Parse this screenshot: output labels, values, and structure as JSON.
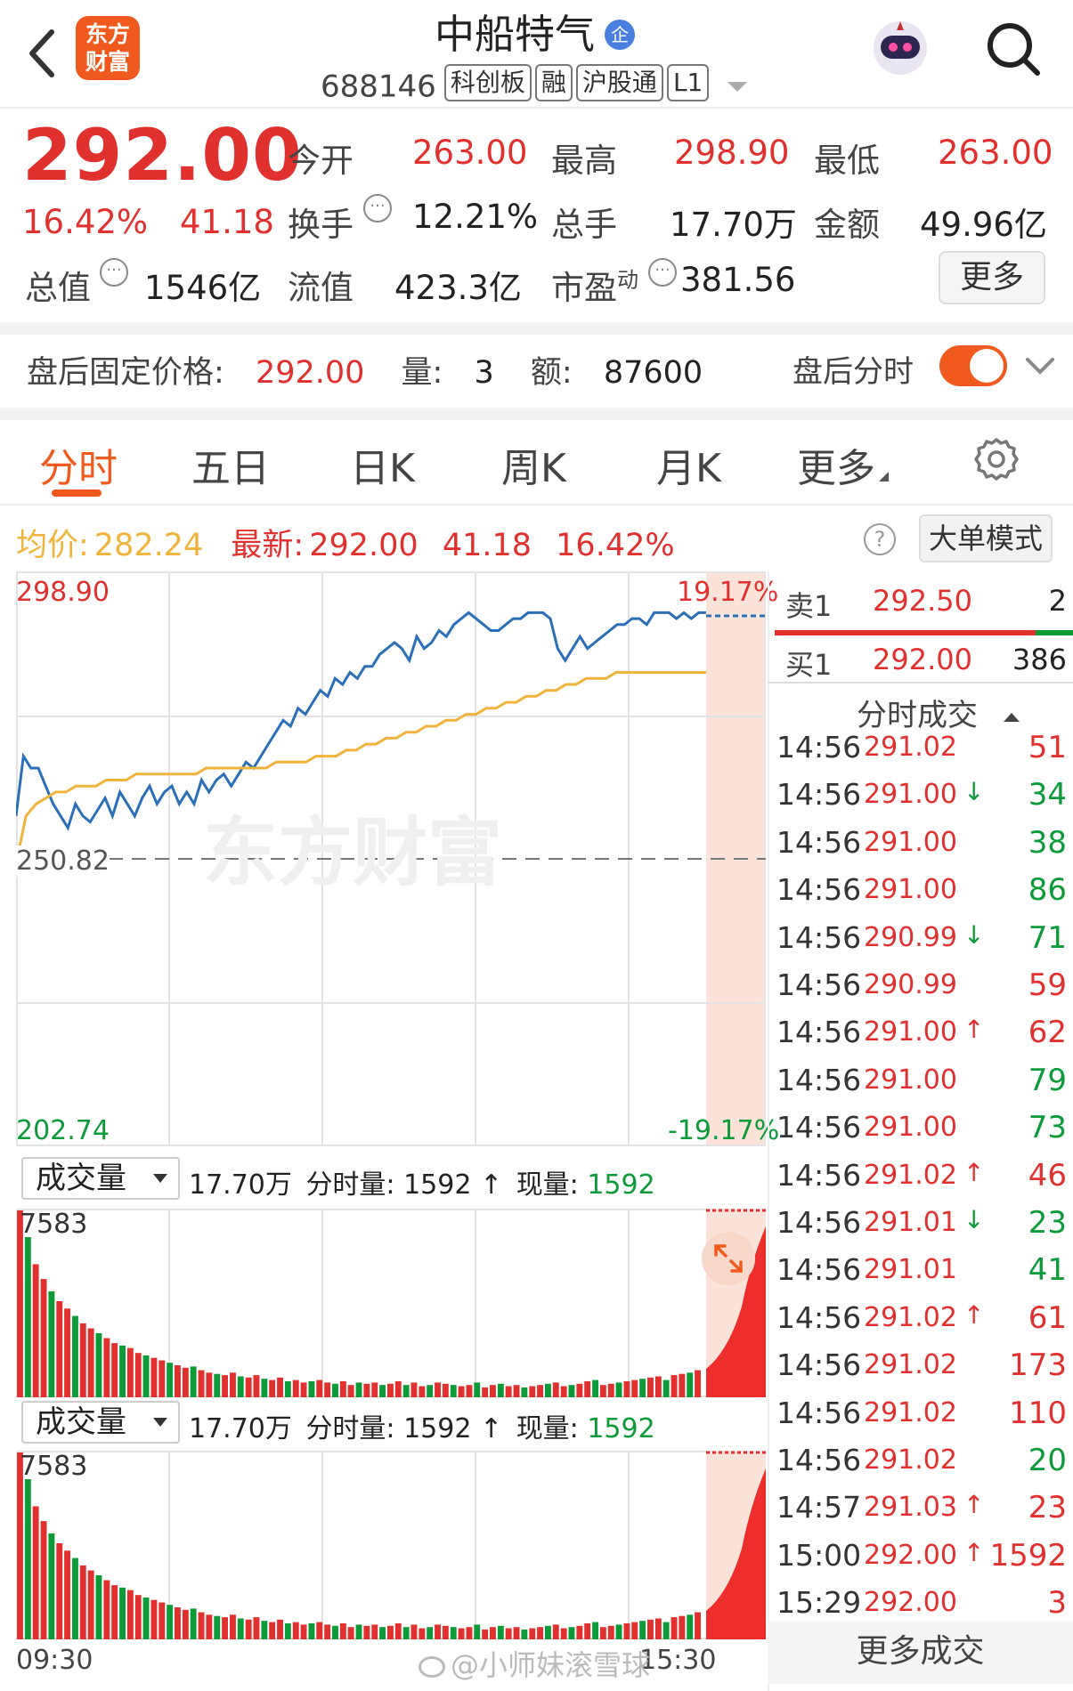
{
  "header": {
    "app_logo": "东方财富",
    "stock_name": "中船特气",
    "enterprise_badge": "企",
    "stock_code": "688146",
    "tags": [
      "科创板",
      "融",
      "沪股通",
      "L1"
    ]
  },
  "quote": {
    "price": "292.00",
    "change_pct": "16.42%",
    "change": "41.18",
    "stats": [
      {
        "label": "今开",
        "value": "263.00"
      },
      {
        "label": "最高",
        "value": "298.90"
      },
      {
        "label": "最低",
        "value": "263.00"
      },
      {
        "label": "换手",
        "value": "12.21%"
      },
      {
        "label": "总手",
        "value": "17.70万"
      },
      {
        "label": "金额",
        "value": "49.96亿"
      },
      {
        "label": "总值",
        "value": "1546亿"
      },
      {
        "label": "流值",
        "value": "423.3亿"
      },
      {
        "label": "市盈",
        "label_sup": "动",
        "value": "381.56"
      }
    ],
    "more_label": "更多"
  },
  "after_hours": {
    "price_label": "盘后固定价格:",
    "price": "292.00",
    "volume_label": "量:",
    "volume": "3",
    "amount_label": "额:",
    "amount": "87600",
    "toggle_label": "盘后分时",
    "toggle_on": true
  },
  "tabs": [
    "分时",
    "五日",
    "日K",
    "周K",
    "月K",
    "更多"
  ],
  "active_tab": 0,
  "info_bar": {
    "avg_label": "均价:",
    "avg": "282.24",
    "latest_label": "最新:",
    "latest": "292.00",
    "change": "41.18",
    "change_pct": "16.42%",
    "big_order_button": "大单模式"
  },
  "chart_data": [
    {
      "type": "line",
      "x_start": "09:30",
      "x_end": "15:30",
      "y_max": "298.90",
      "y_mid": "250.82",
      "y_min": "202.74",
      "pct_max": "19.17%",
      "pct_min": "-19.17%",
      "watermark": "东方财富",
      "ylim": [
        202.74,
        298.9
      ],
      "series": [
        {
          "values": [
            258,
            268,
            266,
            266,
            263,
            260,
            258,
            256,
            260,
            258,
            257,
            259,
            261,
            258,
            262,
            260,
            258,
            261,
            263,
            260,
            262,
            263,
            260,
            262,
            260,
            264,
            262,
            264,
            265,
            263,
            265,
            267,
            266,
            268,
            270,
            272,
            274,
            273,
            276,
            275,
            277,
            279,
            278,
            281,
            280,
            282,
            281,
            283,
            283,
            285,
            286,
            287,
            286,
            284,
            288,
            286,
            287,
            289,
            288,
            290,
            291,
            292,
            291,
            290,
            289,
            289,
            290,
            291,
            291,
            292,
            292,
            292,
            291,
            286,
            284,
            286,
            288,
            286,
            287,
            288,
            289,
            290,
            290,
            291,
            291,
            290,
            292,
            292,
            292,
            291,
            292,
            291,
            292,
            292
          ]
        },
        {
          "values": [
            250,
            258,
            260,
            261,
            262,
            262,
            263,
            263,
            263,
            264,
            264,
            264,
            265,
            265,
            265,
            265,
            265,
            265,
            265,
            266,
            266,
            266,
            266,
            266,
            266,
            266,
            267,
            267,
            267,
            267,
            268,
            268,
            268,
            269,
            269,
            270,
            270,
            271,
            271,
            272,
            272,
            273,
            273,
            274,
            274,
            275,
            275,
            276,
            276,
            277,
            277,
            278,
            278,
            279,
            279,
            280,
            280,
            281,
            281,
            281,
            282,
            282,
            282,
            282,
            282,
            282,
            282,
            282,
            282,
            282
          ]
        }
      ]
    },
    {
      "type": "bar",
      "title": "成交量",
      "ymax": "7583",
      "values": [
        7583,
        6500,
        5400,
        4800,
        4300,
        3900,
        3600,
        3300,
        3000,
        2800,
        2600,
        2400,
        2200,
        2100,
        2000,
        1800,
        1700,
        1600,
        1500,
        1400,
        1300,
        1200,
        1250,
        1100,
        1000,
        950,
        900,
        1000,
        850,
        800,
        900,
        750,
        700,
        800,
        650,
        700,
        600,
        650,
        700,
        600,
        550,
        650,
        500,
        600,
        550,
        600,
        500,
        550,
        650,
        500,
        600,
        450,
        500,
        600,
        550,
        500,
        450,
        500,
        600,
        400,
        500,
        550,
        450,
        500,
        400,
        450,
        500,
        550,
        600,
        450,
        500,
        550,
        650,
        700,
        500,
        550,
        600,
        650,
        700,
        750,
        800,
        850,
        700,
        900,
        950,
        1000,
        1100
      ]
    },
    {
      "type": "bar",
      "title": "成交量",
      "ymax": "7583",
      "values": [
        7583,
        6500,
        5400,
        4800,
        4300,
        3900,
        3600,
        3300,
        3000,
        2800,
        2600,
        2400,
        2200,
        2100,
        2000,
        1800,
        1700,
        1600,
        1500,
        1400,
        1300,
        1200,
        1250,
        1100,
        1000,
        950,
        900,
        1000,
        850,
        800,
        900,
        750,
        700,
        800,
        650,
        700,
        600,
        650,
        700,
        600,
        550,
        650,
        500,
        600,
        550,
        600,
        500,
        550,
        650,
        500,
        600,
        450,
        500,
        600,
        550,
        500,
        450,
        500,
        600,
        400,
        500,
        550,
        450,
        500,
        400,
        450,
        500,
        550,
        600,
        450,
        500,
        550,
        650,
        700,
        500,
        550,
        600,
        650,
        700,
        750,
        800,
        850,
        700,
        900,
        950,
        1000,
        1100
      ]
    }
  ],
  "volume_bar": {
    "selector": "成交量",
    "total": "17.70万",
    "minute_label": "分时量:",
    "minute_value": "1592",
    "arrow": "↑",
    "current_label": "现量:",
    "current_value": "1592"
  },
  "order_book": {
    "sell_label": "卖1",
    "sell_price": "292.50",
    "sell_qty": "2",
    "buy_label": "买1",
    "buy_price": "292.00",
    "buy_qty": "386"
  },
  "trades_title": "分时成交",
  "trades": [
    {
      "time": "14:56",
      "price": "291.02",
      "arrow": "",
      "qty": "51",
      "color": "red"
    },
    {
      "time": "14:56",
      "price": "291.00",
      "arrow": "↓",
      "qty": "34",
      "color": "green"
    },
    {
      "time": "14:56",
      "price": "291.00",
      "arrow": "",
      "qty": "38",
      "color": "green"
    },
    {
      "time": "14:56",
      "price": "291.00",
      "arrow": "",
      "qty": "86",
      "color": "green"
    },
    {
      "time": "14:56",
      "price": "290.99",
      "arrow": "↓",
      "qty": "71",
      "color": "green"
    },
    {
      "time": "14:56",
      "price": "290.99",
      "arrow": "",
      "qty": "59",
      "color": "red"
    },
    {
      "time": "14:56",
      "price": "291.00",
      "arrow": "↑",
      "qty": "62",
      "color": "red"
    },
    {
      "time": "14:56",
      "price": "291.00",
      "arrow": "",
      "qty": "79",
      "color": "green"
    },
    {
      "time": "14:56",
      "price": "291.00",
      "arrow": "",
      "qty": "73",
      "color": "green"
    },
    {
      "time": "14:56",
      "price": "291.02",
      "arrow": "↑",
      "qty": "46",
      "color": "red"
    },
    {
      "time": "14:56",
      "price": "291.01",
      "arrow": "↓",
      "qty": "23",
      "color": "green"
    },
    {
      "time": "14:56",
      "price": "291.01",
      "arrow": "",
      "qty": "41",
      "color": "green"
    },
    {
      "time": "14:56",
      "price": "291.02",
      "arrow": "↑",
      "qty": "61",
      "color": "red"
    },
    {
      "time": "14:56",
      "price": "291.02",
      "arrow": "",
      "qty": "173",
      "color": "red"
    },
    {
      "time": "14:56",
      "price": "291.02",
      "arrow": "",
      "qty": "110",
      "color": "red"
    },
    {
      "time": "14:56",
      "price": "291.02",
      "arrow": "",
      "qty": "20",
      "color": "green"
    },
    {
      "time": "14:57",
      "price": "291.03",
      "arrow": "↑",
      "qty": "23",
      "color": "red"
    },
    {
      "time": "15:00",
      "price": "292.00",
      "arrow": "↑",
      "qty": "1592",
      "color": "red"
    },
    {
      "time": "15:29",
      "price": "292.00",
      "arrow": "",
      "qty": "3",
      "color": "red"
    }
  ],
  "more_trades": "更多成交",
  "footer": {
    "time_start": "09:30",
    "time_end": "15:30",
    "weibo_watermark": "@小师妹滚雪球"
  },
  "colors": {
    "red": "#e0312f",
    "green": "#0d9b3a",
    "blue": "#2a6fb8",
    "avg": "#f0b43c",
    "orange": "#f05a1e"
  }
}
